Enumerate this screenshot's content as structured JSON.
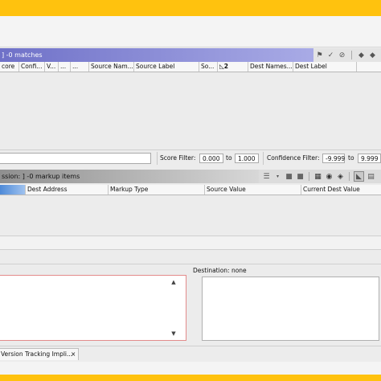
{
  "matches_panel": {
    "title": "] -0 matches",
    "columns": [
      "core",
      "Confi...",
      "V...",
      "...",
      "...",
      "Source Nam...",
      "Source Label",
      "So...",
      "◺2",
      "Dest Names...",
      "Dest Label"
    ],
    "icons": [
      "flag-icon",
      "check-icon",
      "reject-icon",
      "tag-icon",
      "tags-icon"
    ]
  },
  "filters": {
    "score_label": "Score Filter:",
    "score_min": "0.000",
    "to1": "to",
    "score_max": "1.000",
    "confidence_label": "Confidence Filter:",
    "conf_min": "-9.999",
    "to2": "to",
    "conf_max": "9.999"
  },
  "markup_panel": {
    "title": "ssion: ] -0 markup items",
    "columns": [
      "",
      "Dest Address",
      "Markup Type",
      "Source Value",
      "Current Dest Value"
    ]
  },
  "source_pane": {},
  "destination_pane": {
    "label": "Destination: none"
  },
  "tab": {
    "label": "Version Tracking Impli...",
    "close": "×"
  }
}
